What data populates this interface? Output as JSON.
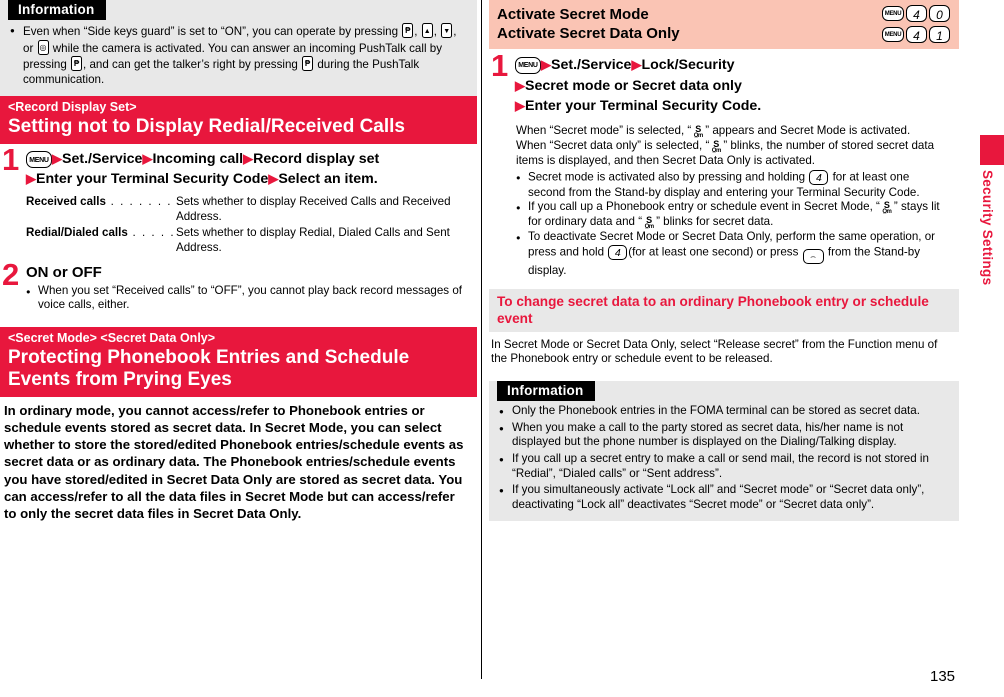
{
  "page": {
    "number": "135",
    "side_tab_label": "Security Settings",
    "accent_red": "#e8173d",
    "band_pink": "#fac4b4",
    "band_gray": "#e8e8e8"
  },
  "left": {
    "info_top": {
      "title": "Information",
      "bullets": [
        {
          "parts": [
            {
              "t": "text",
              "v": "Even when “Side keys guard” is set to “ON”, you can operate by pressing "
            },
            {
              "t": "key-side",
              "v": "ptt"
            },
            {
              "t": "text",
              "v": ", "
            },
            {
              "t": "key-side",
              "v": "up"
            },
            {
              "t": "text",
              "v": ", "
            },
            {
              "t": "key-side",
              "v": "down"
            },
            {
              "t": "text",
              "v": ", or "
            },
            {
              "t": "key-side",
              "v": "camera"
            },
            {
              "t": "text",
              "v": " while the camera is activated. You can answer an incoming PushTalk call by pressing "
            },
            {
              "t": "key-side",
              "v": "ptt"
            },
            {
              "t": "text",
              "v": ", and can get the talker’s right by pressing "
            },
            {
              "t": "key-side",
              "v": "ptt"
            },
            {
              "t": "text",
              "v": " during the PushTalk communication."
            }
          ]
        }
      ]
    },
    "section1": {
      "eyebrow": "<Record Display Set>",
      "title": "Setting not to Display Redial/Received Calls",
      "step1": {
        "number": "1",
        "key": "MENU",
        "line1_items": [
          "Set./Service",
          "Incoming call",
          "Record display set"
        ],
        "line2_items": [
          "Enter your Terminal Security Code",
          "Select an item."
        ]
      },
      "definitions": [
        {
          "term": "Received calls",
          "dots": ". . . . . . . .",
          "desc": "Sets whether to display Received Calls and Received Address."
        },
        {
          "term": "Redial/Dialed calls",
          "dots": ". . . . .",
          "desc": "Sets whether to display Redial, Dialed Calls and Sent Address."
        }
      ],
      "step2": {
        "number": "2",
        "title": "ON or OFF",
        "bullets": [
          "When you set “Received calls” to “OFF”, you cannot play back record messages of voice calls, either."
        ]
      }
    },
    "section2": {
      "eyebrow": "<Secret Mode> <Secret Data Only>",
      "title": "Protecting Phonebook Entries and Schedule Events from Prying Eyes",
      "body": "In ordinary mode, you cannot access/refer to Phonebook entries or schedule events stored as secret data. In Secret Mode, you can select whether to store the stored/edited Phonebook entries/schedule events as secret data or as ordinary data. The Phonebook entries/schedule events you have stored/edited in Secret Data Only are stored as secret data. You can access/refer to all the data files in Secret Mode but can access/refer to only the secret data files in Secret Data Only."
    }
  },
  "right": {
    "header": {
      "row1_label": "Activate Secret Mode",
      "row1_keys": [
        "MENU",
        "4",
        "0"
      ],
      "row2_label": "Activate Secret Data Only",
      "row2_keys": [
        "MENU",
        "4",
        "1"
      ]
    },
    "step1": {
      "number": "1",
      "key": "MENU",
      "line1_items": [
        "Set./Service",
        "Lock/Security"
      ],
      "line2_items": [
        "Secret mode or Secret data only"
      ],
      "line3_items": [
        "Enter your Terminal Security Code."
      ]
    },
    "body_paragraph": {
      "parts": [
        {
          "t": "text",
          "v": "When “Secret mode” is selected, “"
        },
        {
          "t": "secret-icon",
          "v": "S"
        },
        {
          "t": "text",
          "v": "” appears and Secret Mode is activated. When “Secret data only” is selected, “"
        },
        {
          "t": "secret-icon",
          "v": "S"
        },
        {
          "t": "text",
          "v": "” blinks, the number of stored secret data items is displayed, and then Secret Data Only is activated."
        }
      ]
    },
    "bullets": [
      {
        "parts": [
          {
            "t": "text",
            "v": "Secret mode is activated also by pressing and holding "
          },
          {
            "t": "key-num",
            "v": "4"
          },
          {
            "t": "text",
            "v": " for at least one second from the Stand-by display and entering your Terminal Security Code."
          }
        ]
      },
      {
        "parts": [
          {
            "t": "text",
            "v": "If you call up a Phonebook entry or schedule event in Secret Mode, “"
          },
          {
            "t": "secret-icon",
            "v": "S"
          },
          {
            "t": "text",
            "v": "” stays lit for ordinary data and “"
          },
          {
            "t": "secret-icon",
            "v": "S"
          },
          {
            "t": "text",
            "v": "” blinks for secret data."
          }
        ]
      },
      {
        "parts": [
          {
            "t": "text",
            "v": "To deactivate Secret Mode or Secret Data Only, perform the same operation, or press and hold "
          },
          {
            "t": "key-num",
            "v": "4"
          },
          {
            "t": "text",
            "v": "(for at least one second) or press "
          },
          {
            "t": "key-end",
            "v": "end"
          },
          {
            "t": "text",
            "v": " from the Stand-by display."
          }
        ]
      }
    ],
    "subsection": {
      "title": "To change secret data to an ordinary Phonebook entry or schedule event",
      "body": "In Secret Mode or Secret Data Only, select “Release secret” from the Function menu of the Phonebook entry or schedule event to be released."
    },
    "info_box": {
      "title": "Information",
      "bullets": [
        "Only the Phonebook entries in the FOMA terminal can be stored as secret data.",
        "When you make a call to the party stored as secret data, his/her name is not displayed but the phone number is displayed on the Dialing/Talking display.",
        "If you call up a secret entry to make a call or send mail, the record is not stored in “Redial”, “Dialed calls” or “Sent address”.",
        "If you simultaneously activate “Lock all” and “Secret mode” or “Secret data only”, deactivating “Lock all” deactivates “Secret mode” or “Secret data only”."
      ]
    }
  }
}
